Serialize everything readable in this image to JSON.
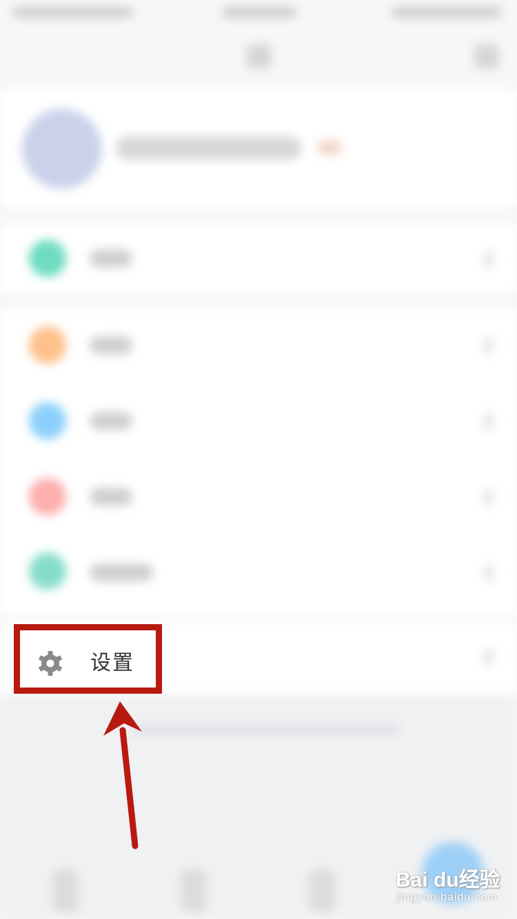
{
  "settings_item": {
    "label": "设置",
    "icon": "gear-icon"
  },
  "annotation": {
    "highlight_color": "#b81a10",
    "arrow_color": "#b81a10"
  },
  "watermark": {
    "brand": "Bai du经验",
    "url": "jingyan.baidu.com"
  },
  "colors": {
    "page_background": "#f7f7f7",
    "row_icon_colors": [
      "#6fdcc1",
      "#ffc08a",
      "#8cd0fb",
      "#fdaeae",
      "#86ddcb"
    ]
  }
}
